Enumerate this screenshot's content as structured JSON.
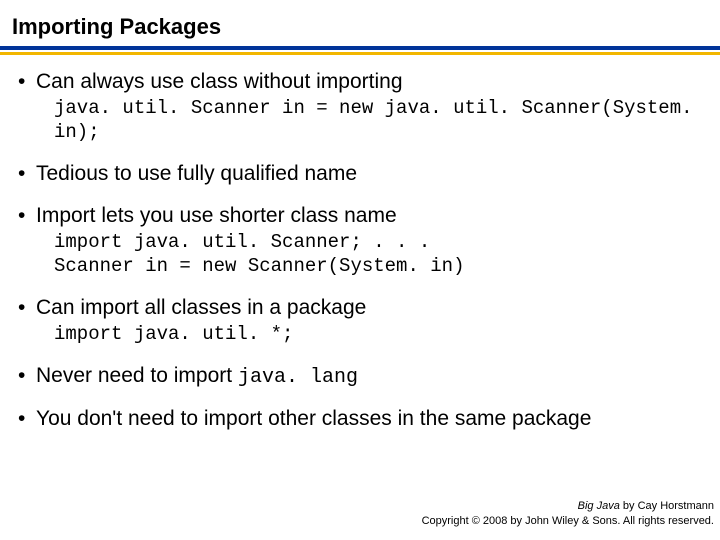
{
  "title": "Importing Packages",
  "bullets": {
    "b1": {
      "text": "Can always use class without importing",
      "code": "java. util. Scanner in = new java. util. Scanner(System. in);"
    },
    "b2": {
      "text": "Tedious to use fully qualified name"
    },
    "b3": {
      "text": "Import lets you use shorter class name",
      "code": "import java. util. Scanner; . . .\nScanner in = new Scanner(System. in)"
    },
    "b4": {
      "text": "Can import all classes in a package",
      "code": "import java. util. *;"
    },
    "b5": {
      "prefix": "Never need to import ",
      "code_inline": "java. lang"
    },
    "b6": {
      "text": "You don't need to import other classes in the same package"
    }
  },
  "footer": {
    "line1_book": "Big Java",
    "line1_rest": " by Cay Horstmann",
    "line2": "Copyright © 2008 by John Wiley & Sons. All rights reserved."
  }
}
